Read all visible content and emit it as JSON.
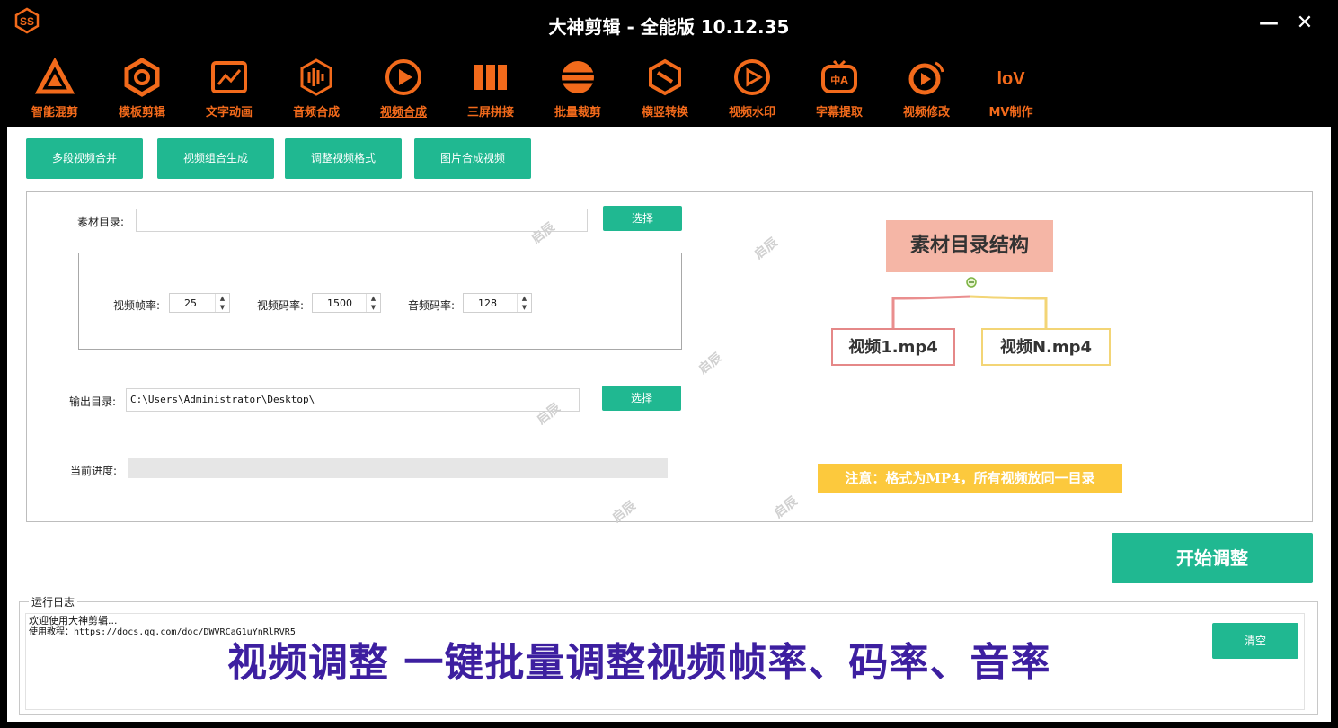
{
  "window": {
    "title": "大神剪辑 - 全能版 10.12.35",
    "minimize_label": "—",
    "close_label": "✕"
  },
  "nav": {
    "items": [
      {
        "label": "智能混剪",
        "icon": "triangle-logo-icon"
      },
      {
        "label": "模板剪辑",
        "icon": "hexagon-q-icon"
      },
      {
        "label": "文字动画",
        "icon": "picture-frame-icon"
      },
      {
        "label": "音频合成",
        "icon": "audio-wave-globe-icon"
      },
      {
        "label": "视频合成",
        "icon": "video-play-circle-icon"
      },
      {
        "label": "三屏拼接",
        "icon": "three-screen-icon"
      },
      {
        "label": "批量裁剪",
        "icon": "crop-circle-icon"
      },
      {
        "label": "横竖转换",
        "icon": "rotate-cube-icon"
      },
      {
        "label": "视频水印",
        "icon": "watermark-play-icon"
      },
      {
        "label": "字幕提取",
        "icon": "subtitle-tv-icon"
      },
      {
        "label": "视频修改",
        "icon": "video-edit-icon"
      },
      {
        "label": "MV制作",
        "icon": "mv-logo-icon"
      }
    ],
    "active": "视频合成",
    "accent_color": "#f26a1b"
  },
  "subtabs": [
    "多段视频合并",
    "视频组合生成",
    "调整视频格式",
    "图片合成视频"
  ],
  "form": {
    "source_dir_label": "素材目录:",
    "source_dir_value": "",
    "select_label": "选择",
    "frame_rate_label": "视频帧率:",
    "frame_rate_value": "25",
    "video_bitrate_label": "视频码率:",
    "video_bitrate_value": "1500",
    "audio_bitrate_label": "音频码率:",
    "audio_bitrate_value": "128",
    "output_dir_label": "输出目录:",
    "output_dir_value": "C:\\Users\\Administrator\\Desktop\\",
    "output_select_label": "选择",
    "progress_label": "当前进度:",
    "progress_value": 0
  },
  "diagram": {
    "title": "素材目录结构",
    "node_first": "视频1.mp4",
    "node_last": "视频N.mp4",
    "notice": "注意：格式为MP4，所有视频放同一目录"
  },
  "watermark_text": "启辰",
  "start_button": "开始调整",
  "log": {
    "title": "运行日志",
    "line1": "欢迎使用大神剪辑...",
    "line2": "使用教程：https://docs.qq.com/doc/DWVRCaG1uYnRlRVR5",
    "clear_label": "清空"
  },
  "banner": "视频调整 一键批量调整视频帧率、码率、音率",
  "colors": {
    "green": "#20b891",
    "banner": "#3d1fa0",
    "notice_bg": "#fcc93d"
  }
}
